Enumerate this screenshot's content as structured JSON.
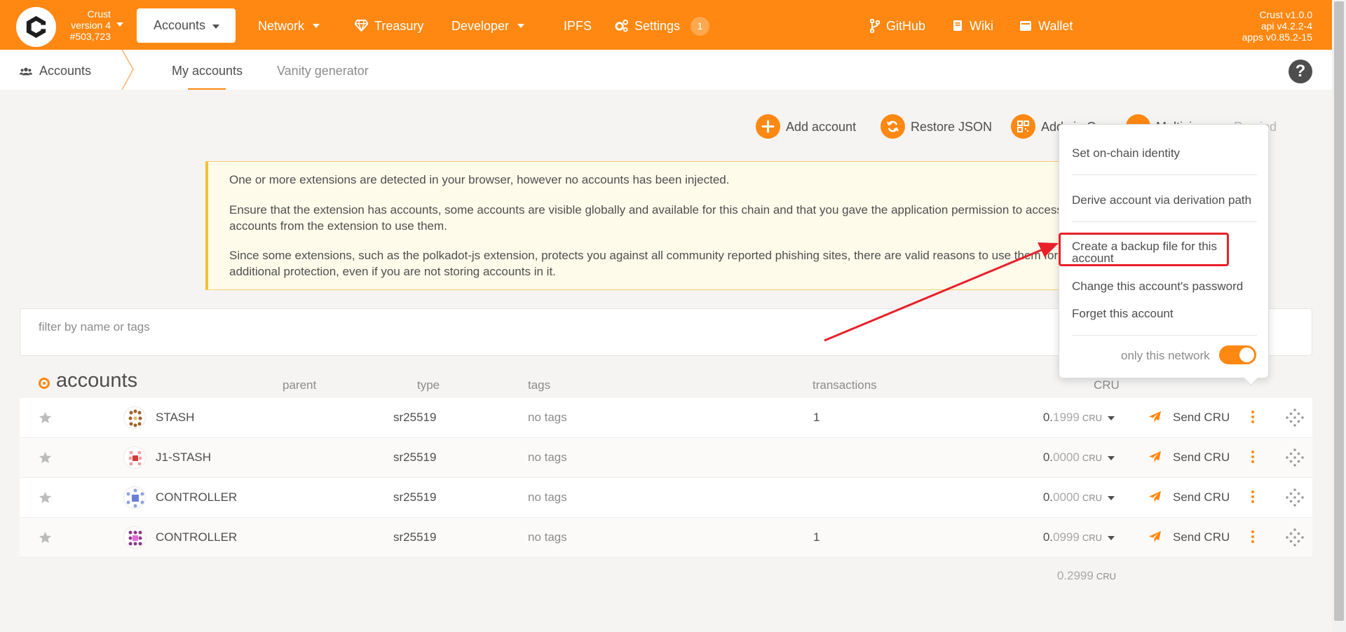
{
  "topbar": {
    "chain_name": "Crust",
    "chain_version": "version 4",
    "block_number": "#503,723",
    "nav": {
      "accounts": "Accounts",
      "network": "Network",
      "treasury": "Treasury",
      "developer": "Developer",
      "ipfs": "IPFS",
      "settings": "Settings",
      "settings_badge": "1",
      "github": "GitHub",
      "wiki": "Wiki",
      "wallet": "Wallet"
    },
    "versions": {
      "crust": "Crust v1.0.0",
      "api": "api v4.2.2-4",
      "apps": "apps v0.85.2-15"
    }
  },
  "subnav": {
    "section": "Accounts",
    "tabs": [
      "My accounts",
      "Vanity generator"
    ],
    "help": "?"
  },
  "actions": {
    "add_account": "Add account",
    "restore_json": "Restore JSON",
    "add_via_qr": "Add via Q",
    "multisig": "Multisi",
    "proxied": "Proxied"
  },
  "warning": {
    "p1": "One or more extensions are detected in your browser, however no accounts has been injected.",
    "p2a": "Ensure that the extension has accounts, some accounts are visible globally and available for this chain and that you gave the application permission to access",
    "p2b": "accounts from the extension to use them.",
    "p3a": "Since some extensions, such as the polkadot-js extension, protects you against all community reported phishing sites, there are valid reasons to use them for",
    "p3b": "additional protection, even if you are not storing accounts in it."
  },
  "filter": {
    "placeholder": "filter by name or tags"
  },
  "table": {
    "title": "accounts",
    "headers": {
      "parent": "parent",
      "type": "type",
      "tags": "tags",
      "transactions": "transactions",
      "balance": "CRU"
    },
    "rows": [
      {
        "name": "STASH",
        "type": "sr25519",
        "tags": "no tags",
        "transactions": "1",
        "balance_int": "0.",
        "balance_dec": "1999",
        "unit": "CRU",
        "send": "Send CRU"
      },
      {
        "name": "J1-STASH",
        "type": "sr25519",
        "tags": "no tags",
        "transactions": "",
        "balance_int": "0.",
        "balance_dec": "0000",
        "unit": "CRU",
        "send": "Send CRU"
      },
      {
        "name": "CONTROLLER",
        "type": "sr25519",
        "tags": "no tags",
        "transactions": "",
        "balance_int": "0.",
        "balance_dec": "0000",
        "unit": "CRU",
        "send": "Send CRU"
      },
      {
        "name": "CONTROLLER",
        "type": "sr25519",
        "tags": "no tags",
        "transactions": "1",
        "balance_int": "0.",
        "balance_dec": "0999",
        "unit": "CRU",
        "send": "Send CRU"
      }
    ],
    "total": {
      "int": "0.",
      "dec": "2999",
      "unit": "CRU"
    }
  },
  "popup_menu": {
    "set_identity": "Set on-chain identity",
    "derive": "Derive account via derivation path",
    "backup_line1": "Create a backup file for this",
    "backup_line2": "account",
    "change_password": "Change this account's password",
    "forget": "Forget this account",
    "only_network": "only this network",
    "only_network_on": true
  },
  "colors": {
    "brand": "#ff8812",
    "highlight": "#e8202a",
    "warning_border": "#f1c232"
  },
  "icons": [
    "crust-logo-icon",
    "gem-icon",
    "gear-icon",
    "branch-icon",
    "book-icon",
    "wallet-icon",
    "users-icon",
    "plus-icon",
    "sync-icon",
    "qr-icon",
    "star-icon",
    "paper-plane-icon",
    "kebab-icon",
    "move-icon",
    "help-icon"
  ]
}
